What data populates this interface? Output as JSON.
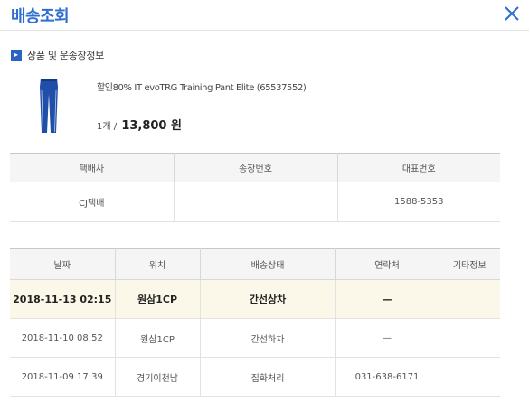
{
  "header": {
    "title": "배송조회"
  },
  "section": {
    "label": "상품 및 운송장정보"
  },
  "product": {
    "name": "할인80% IT evoTRG Training Pant Elite (65537552)",
    "quantity": "1개 /",
    "price": "13,800 원"
  },
  "shipping": {
    "columns": [
      "택배사",
      "송장번호",
      "대표번호"
    ],
    "row": {
      "carrier": "CJ택배",
      "tracking_number": "",
      "phone": "1588-5353"
    }
  },
  "tracking": {
    "columns": [
      "날짜",
      "위치",
      "배송상태",
      "연락처",
      "기타정보"
    ],
    "rows": [
      {
        "date": "2018-11-13 02:15",
        "location": "원삼1CP",
        "status": "간선상차",
        "contact": "—",
        "etc": ""
      },
      {
        "date": "2018-11-10 08:52",
        "location": "원삼1CP",
        "status": "간선하차",
        "contact": "—",
        "etc": ""
      },
      {
        "date": "2018-11-09 17:39",
        "location": "경기이천남",
        "status": "집화처리",
        "contact": "031-638-6171",
        "etc": ""
      }
    ]
  },
  "colors": {
    "accent": "#2f6fcf",
    "highlight_row": "#fcf8e9",
    "product_blue": "#1f4fa8"
  },
  "icons": {
    "close": "close-icon",
    "section_bullet": "arrow-bullet-icon",
    "product": "pants-thumbnail"
  }
}
